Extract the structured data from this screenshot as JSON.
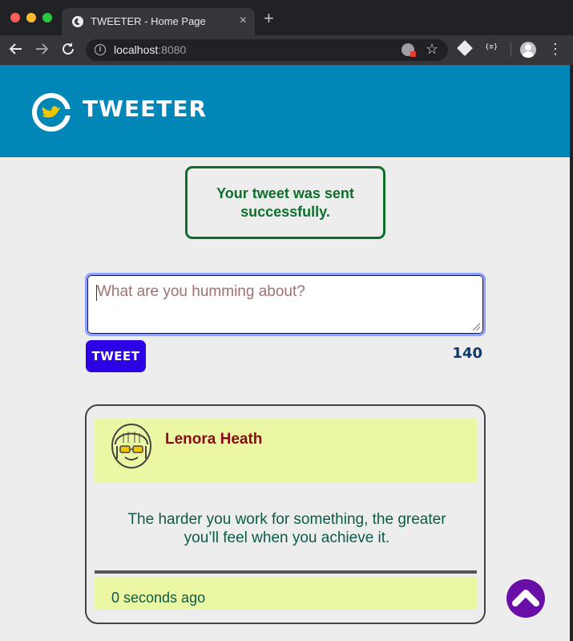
{
  "browser": {
    "tab_title": "TWEETER - Home Page",
    "tab_close": "×",
    "new_tab": "+",
    "url_host": "localhost",
    "url_port": ":8080",
    "ext_label": "{≡}"
  },
  "header": {
    "brand": "TWEETER"
  },
  "flash": {
    "message": "Your tweet was sent successfully."
  },
  "composer": {
    "placeholder": "What are you humming about?",
    "button_label": "TWEET",
    "counter": "140"
  },
  "tweet": {
    "user_name": "Lenora Heath",
    "content": "The harder you work for something, the greater you’ll feel when you achieve it.",
    "timestamp": "0 seconds ago"
  },
  "colors": {
    "header_bg": "#0087b8",
    "flash_green": "#0e6f2c",
    "tweet_button": "#2e00e6",
    "card_highlight": "#ecf7a4",
    "scroll_button": "#6a0ea8"
  }
}
